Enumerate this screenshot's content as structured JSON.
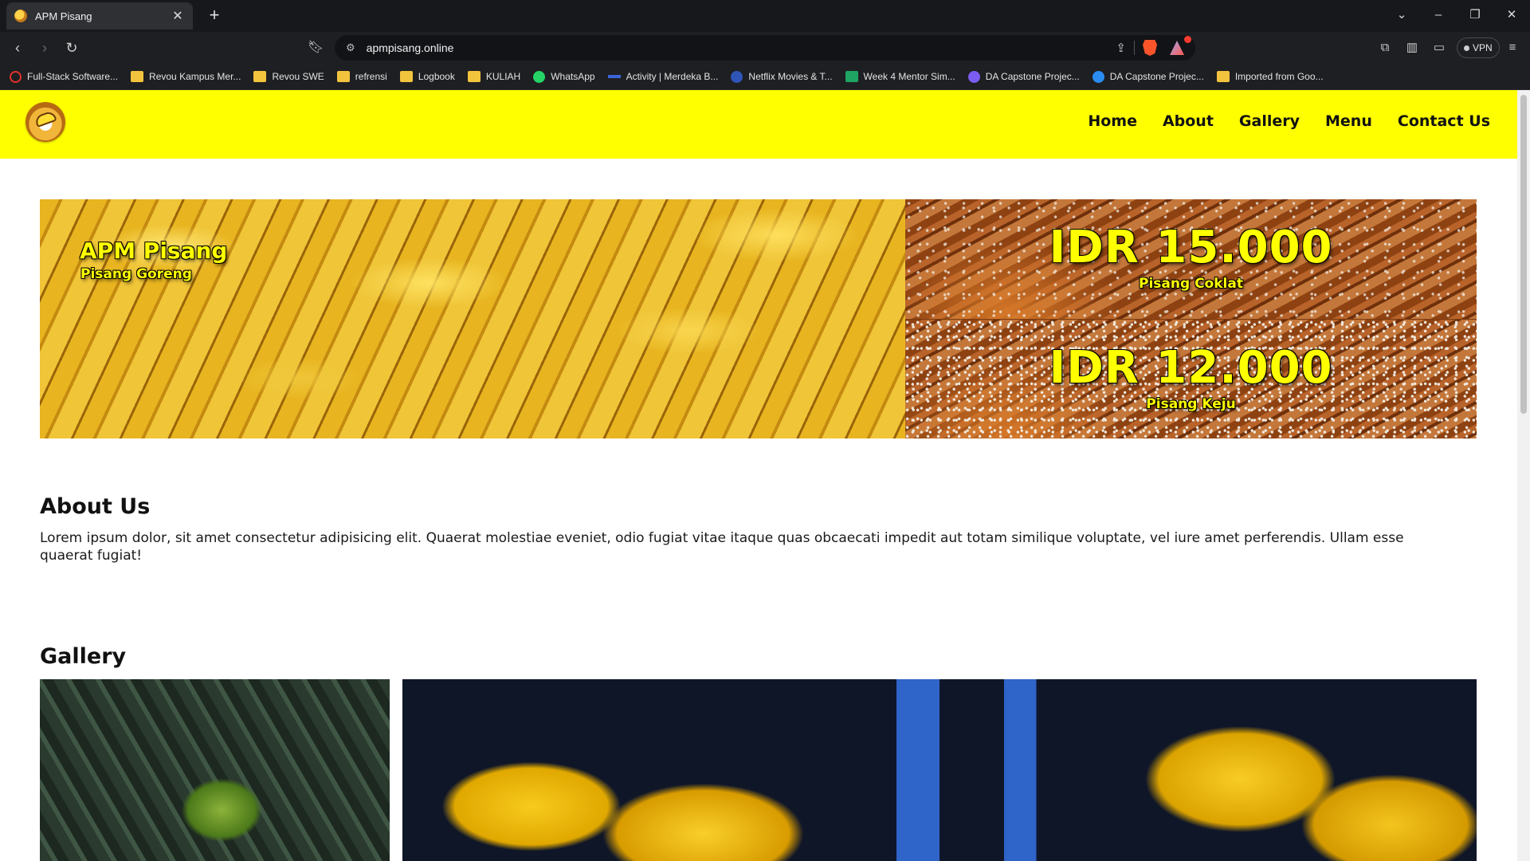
{
  "browser": {
    "tab_title": "APM Pisang",
    "url": "apmpisang.online",
    "vpn_label": "VPN",
    "bookmarks": [
      {
        "label": "Full-Stack Software...",
        "icon": "red-ring-icon"
      },
      {
        "label": "Revou Kampus Mer...",
        "icon": "folder-icon"
      },
      {
        "label": "Revou SWE",
        "icon": "folder-icon"
      },
      {
        "label": "refrensi",
        "icon": "folder-icon"
      },
      {
        "label": "Logbook",
        "icon": "folder-icon"
      },
      {
        "label": "KULIAH",
        "icon": "folder-icon"
      },
      {
        "label": "WhatsApp",
        "icon": "whatsapp-icon"
      },
      {
        "label": "Activity | Merdeka B...",
        "icon": "merdeka-icon"
      },
      {
        "label": "Netflix Movies & T...",
        "icon": "netflix-icon"
      },
      {
        "label": "Week 4 Mentor Sim...",
        "icon": "sheets-icon"
      },
      {
        "label": "DA Capstone Projec...",
        "icon": "shield-icon"
      },
      {
        "label": "DA Capstone Projec...",
        "icon": "globe-icon"
      },
      {
        "label": "Imported from Goo...",
        "icon": "folder-icon"
      }
    ]
  },
  "site": {
    "nav": [
      "Home",
      "About",
      "Gallery",
      "Menu",
      "Contact Us"
    ],
    "hero": {
      "brand": "APM Pisang",
      "subtitle": "Pisang Goreng",
      "offers": [
        {
          "price": "IDR 15.000",
          "name": "Pisang Coklat"
        },
        {
          "price": "IDR 12.000",
          "name": "Pisang Keju"
        }
      ]
    },
    "about": {
      "title": "About Us",
      "body": "Lorem ipsum dolor, sit amet consectetur adipisicing elit. Quaerat molestiae eveniet, odio fugiat vitae itaque quas obcaecati impedit aut totam similique voluptate, vel iure amet perferendis. Ullam esse quaerat fugiat!"
    },
    "gallery": {
      "title": "Gallery"
    }
  },
  "colors": {
    "header_bg": "#ffff00",
    "accent_text": "#ffff00",
    "chrome_bg": "#1e1f22"
  }
}
